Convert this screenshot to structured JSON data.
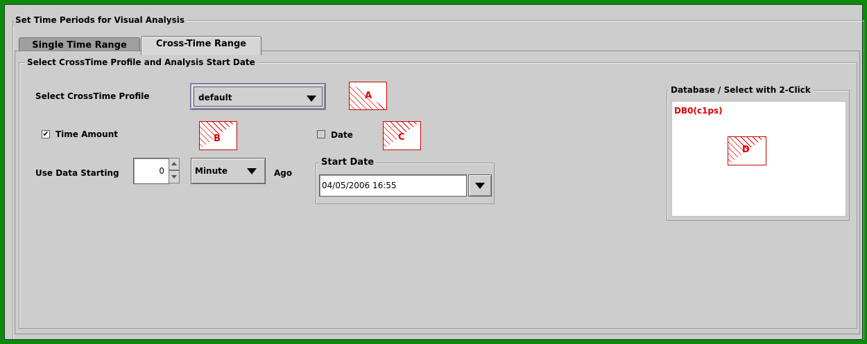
{
  "outer_group": {
    "title": "Set Time Periods for Visual Analysis"
  },
  "tabs": [
    {
      "label": "Single Time Range",
      "active": false
    },
    {
      "label": "Cross-Time Range",
      "active": true
    }
  ],
  "inner_group": {
    "title": "Select CrossTime Profile and Analysis Start Date"
  },
  "profile": {
    "label": "Select CrossTime Profile",
    "value": "default"
  },
  "time_amount": {
    "label": "Time Amount",
    "checked": true,
    "check_glyph": "✔"
  },
  "date_option": {
    "label": "Date",
    "checked": false
  },
  "use_data": {
    "label": "Use Data Starting",
    "value": "0",
    "unit": "Minute",
    "suffix": "Ago"
  },
  "start_date": {
    "title": "Start Date",
    "value": "04/05/2006 16:55"
  },
  "database": {
    "title": "Database / Select with 2-Click",
    "items": [
      "DB0(c1ps)"
    ]
  },
  "markers": [
    "A",
    "B",
    "C",
    "D"
  ],
  "colors": {
    "border_green": "#0c8a0c",
    "panel": "#cdcdcd",
    "marker_red": "#e00000"
  }
}
